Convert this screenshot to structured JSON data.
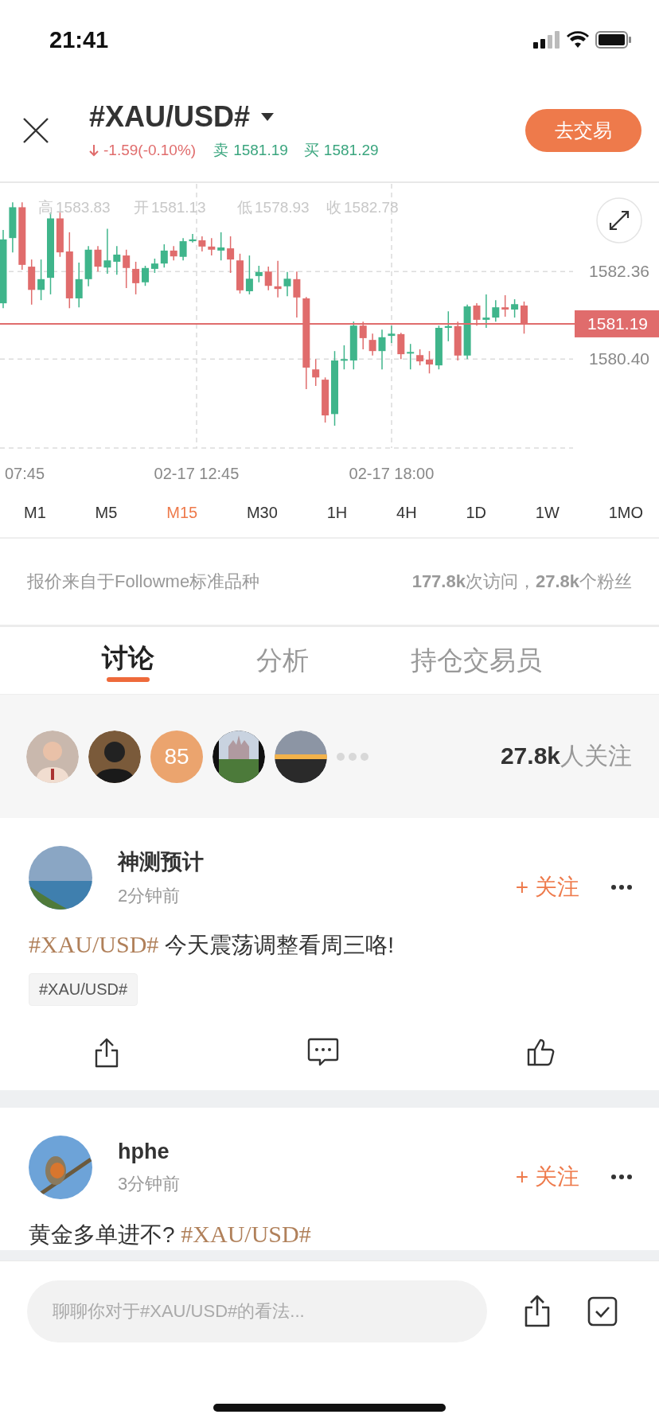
{
  "status_bar": {
    "time": "21:41"
  },
  "header": {
    "symbol": "#XAU/USD#",
    "change": "-1.59(-0.10%)",
    "sell_label": "卖",
    "sell": "1581.19",
    "buy_label": "买",
    "buy": "1581.29",
    "trade_button": "去交易"
  },
  "chart": {
    "ohlc_header": [
      {
        "label": "高",
        "value": "1583.83"
      },
      {
        "label": "开",
        "value": "1581.13"
      },
      {
        "label": "低",
        "value": "1578.93"
      },
      {
        "label": "收",
        "value": "1582.78"
      }
    ],
    "price_tag": "1581.19",
    "x_labels": [
      "07:45",
      "02-17 12:45",
      "02-17 18:00"
    ],
    "chart_data": {
      "type": "candlestick",
      "grid": true,
      "ylim": [
        1578.41,
        1584.36
      ],
      "yticks": [
        {
          "value": 1582.36,
          "label": "1582.36"
        },
        {
          "value": 1580.4,
          "label": "1580.40"
        }
      ],
      "ohlc": [
        [
          1581.65,
          1583.29,
          1581.54,
          1583.08
        ],
        [
          1583.11,
          1583.91,
          1582.79,
          1583.8
        ],
        [
          1583.8,
          1583.91,
          1582.4,
          1582.51
        ],
        [
          1582.47,
          1582.63,
          1581.62,
          1581.95
        ],
        [
          1581.95,
          1582.63,
          1581.72,
          1582.19
        ],
        [
          1582.22,
          1583.68,
          1581.85,
          1583.55
        ],
        [
          1583.55,
          1583.68,
          1582.69,
          1582.79
        ],
        [
          1582.81,
          1583.24,
          1581.54,
          1581.76
        ],
        [
          1581.76,
          1582.56,
          1581.56,
          1582.19
        ],
        [
          1582.19,
          1582.93,
          1582.03,
          1582.85
        ],
        [
          1582.85,
          1582.93,
          1582.36,
          1582.47
        ],
        [
          1582.45,
          1583.32,
          1582.31,
          1582.61
        ],
        [
          1582.58,
          1582.93,
          1582.29,
          1582.74
        ],
        [
          1582.72,
          1582.85,
          1581.99,
          1582.44
        ],
        [
          1582.42,
          1582.58,
          1581.85,
          1582.1
        ],
        [
          1582.12,
          1582.49,
          1582.04,
          1582.44
        ],
        [
          1582.42,
          1582.65,
          1582.33,
          1582.54
        ],
        [
          1582.54,
          1582.97,
          1582.45,
          1582.83
        ],
        [
          1582.83,
          1582.93,
          1582.61,
          1582.7
        ],
        [
          1582.69,
          1583.11,
          1582.61,
          1583.04
        ],
        [
          1583.04,
          1583.2,
          1583.01,
          1583.08
        ],
        [
          1583.06,
          1583.15,
          1582.81,
          1582.92
        ],
        [
          1582.92,
          1583.11,
          1582.72,
          1582.85
        ],
        [
          1582.83,
          1583.24,
          1582.61,
          1582.9
        ],
        [
          1582.88,
          1583.15,
          1582.33,
          1582.63
        ],
        [
          1582.61,
          1582.76,
          1581.87,
          1581.94
        ],
        [
          1581.92,
          1582.72,
          1581.85,
          1582.2
        ],
        [
          1582.26,
          1582.49,
          1582.12,
          1582.35
        ],
        [
          1582.36,
          1582.47,
          1581.94,
          1582.04
        ],
        [
          1582.03,
          1582.6,
          1581.78,
          1581.97
        ],
        [
          1582.03,
          1582.35,
          1581.81,
          1582.2
        ],
        [
          1582.19,
          1582.36,
          1581.33,
          1581.78
        ],
        [
          1581.76,
          1581.79,
          1579.73,
          1580.21
        ],
        [
          1580.17,
          1580.4,
          1579.8,
          1579.99
        ],
        [
          1579.94,
          1579.99,
          1578.98,
          1579.14
        ],
        [
          1579.17,
          1580.58,
          1578.91,
          1580.37
        ],
        [
          1580.37,
          1580.71,
          1580.17,
          1580.4
        ],
        [
          1580.37,
          1581.24,
          1580.17,
          1581.15
        ],
        [
          1581.15,
          1581.24,
          1580.62,
          1580.87
        ],
        [
          1580.83,
          1580.97,
          1580.48,
          1580.58
        ],
        [
          1580.58,
          1581.06,
          1580.17,
          1580.89
        ],
        [
          1580.92,
          1581.15,
          1580.76,
          1580.97
        ],
        [
          1580.96,
          1580.99,
          1580.4,
          1580.51
        ],
        [
          1580.53,
          1580.74,
          1580.17,
          1580.56
        ],
        [
          1580.49,
          1580.62,
          1580.26,
          1580.35
        ],
        [
          1580.39,
          1580.58,
          1580.08,
          1580.28
        ],
        [
          1580.26,
          1581.15,
          1580.17,
          1581.1
        ],
        [
          1581.1,
          1581.47,
          1580.8,
          1581.14
        ],
        [
          1581.14,
          1581.24,
          1580.37,
          1580.48
        ],
        [
          1580.48,
          1581.62,
          1580.4,
          1581.58
        ],
        [
          1581.6,
          1581.65,
          1581.15,
          1581.28
        ],
        [
          1581.28,
          1581.85,
          1581.1,
          1581.33
        ],
        [
          1581.33,
          1581.72,
          1581.24,
          1581.56
        ],
        [
          1581.56,
          1581.83,
          1581.35,
          1581.51
        ],
        [
          1581.51,
          1581.74,
          1581.33,
          1581.63
        ],
        [
          1581.6,
          1581.69,
          1580.97,
          1581.19
        ]
      ]
    }
  },
  "timeframes": [
    {
      "label": "M1",
      "selected": false
    },
    {
      "label": "M5",
      "selected": false
    },
    {
      "label": "M15",
      "selected": true
    },
    {
      "label": "M30",
      "selected": false
    },
    {
      "label": "1H",
      "selected": false
    },
    {
      "label": "4H",
      "selected": false
    },
    {
      "label": "1D",
      "selected": false
    },
    {
      "label": "1W",
      "selected": false
    },
    {
      "label": "1MO",
      "selected": false
    }
  ],
  "info": {
    "source": "报价来自于Followme标准品种",
    "stats": "**177.8k**次访问，**27.8k**个粉丝"
  },
  "tabs": [
    {
      "label": "讨论",
      "selected": true
    },
    {
      "label": "分析",
      "selected": false
    },
    {
      "label": "持仓交易员",
      "selected": false
    }
  ],
  "followers": {
    "avatars": [
      {
        "kind": "picture"
      },
      {
        "kind": "picture"
      },
      {
        "kind": "count",
        "text": "85"
      },
      {
        "kind": "picture"
      },
      {
        "kind": "picture"
      }
    ],
    "count": "27.8k",
    "count_label": "人关注"
  },
  "posts": [
    {
      "author": "神测预计",
      "time": "2分钟前",
      "follow": "+ 关注",
      "body": [
        {
          "kind": "topic",
          "text": "#XAU/USD#"
        },
        {
          "kind": "text",
          "text": " 今天震荡调整看周三咯!"
        }
      ],
      "tags": [
        "#XAU/USD#"
      ]
    },
    {
      "author": "hphe",
      "time": "3分钟前",
      "follow": "+ 关注",
      "body": [
        {
          "kind": "text",
          "text": "黄金多单进不? "
        },
        {
          "kind": "topic",
          "text": "#XAU/USD#"
        }
      ]
    }
  ],
  "composer": {
    "placeholder": "聊聊你对于#XAU/USD#的看法..."
  }
}
